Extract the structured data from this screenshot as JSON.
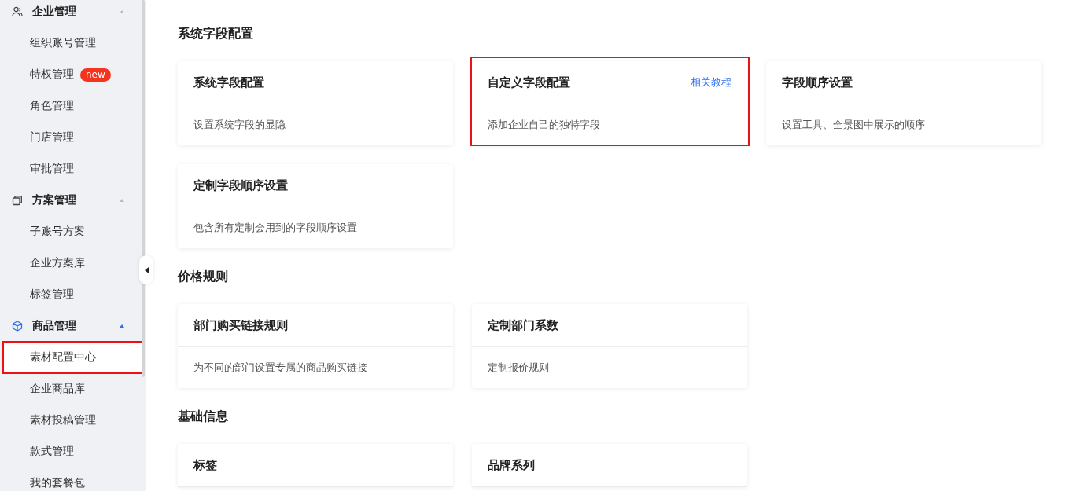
{
  "sidebar": {
    "groups": [
      {
        "title": "企业管理",
        "kind": "people",
        "active": false,
        "expanded": true,
        "items": [
          {
            "label": "组织账号管理",
            "selected": false,
            "highlighted": false
          },
          {
            "label": "特权管理",
            "badge": "new",
            "selected": false,
            "highlighted": false
          },
          {
            "label": "角色管理",
            "selected": false,
            "highlighted": false
          },
          {
            "label": "门店管理",
            "selected": false,
            "highlighted": false
          },
          {
            "label": "审批管理",
            "selected": false,
            "highlighted": false
          }
        ]
      },
      {
        "title": "方案管理",
        "kind": "copy",
        "active": false,
        "expanded": true,
        "items": [
          {
            "label": "子账号方案",
            "selected": false,
            "highlighted": false
          },
          {
            "label": "企业方案库",
            "selected": false,
            "highlighted": false
          },
          {
            "label": "标签管理",
            "selected": false,
            "highlighted": false
          }
        ]
      },
      {
        "title": "商品管理",
        "kind": "cube",
        "active": true,
        "expanded": true,
        "items": [
          {
            "label": "素材配置中心",
            "selected": true,
            "highlighted": true
          },
          {
            "label": "企业商品库",
            "selected": false,
            "highlighted": false
          },
          {
            "label": "素材投稿管理",
            "selected": false,
            "highlighted": false
          },
          {
            "label": "款式管理",
            "selected": false,
            "highlighted": false
          },
          {
            "label": "我的套餐包",
            "selected": false,
            "highlighted": false
          }
        ]
      }
    ]
  },
  "sections": [
    {
      "title": "系统字段配置",
      "cards": [
        {
          "title": "系统字段配置",
          "description": "设置系统字段的显隐",
          "highlighted": false
        },
        {
          "title": "自定义字段配置",
          "link": "相关教程",
          "description": "添加企业自己的独特字段",
          "highlighted": true
        },
        {
          "title": "字段顺序设置",
          "description": "设置工具、全景图中展示的顺序",
          "highlighted": false
        },
        {
          "title": "定制字段顺序设置",
          "description": "包含所有定制会用到的字段顺序设置",
          "highlighted": false
        }
      ]
    },
    {
      "title": "价格规则",
      "cards": [
        {
          "title": "部门购买链接规则",
          "description": "为不同的部门设置专属的商品购买链接",
          "highlighted": false
        },
        {
          "title": "定制部门系数",
          "description": "定制报价规则",
          "highlighted": false
        }
      ]
    },
    {
      "title": "基础信息",
      "cards": [
        {
          "title": "标签",
          "highlighted": false
        },
        {
          "title": "品牌系列",
          "highlighted": false
        }
      ]
    }
  ]
}
